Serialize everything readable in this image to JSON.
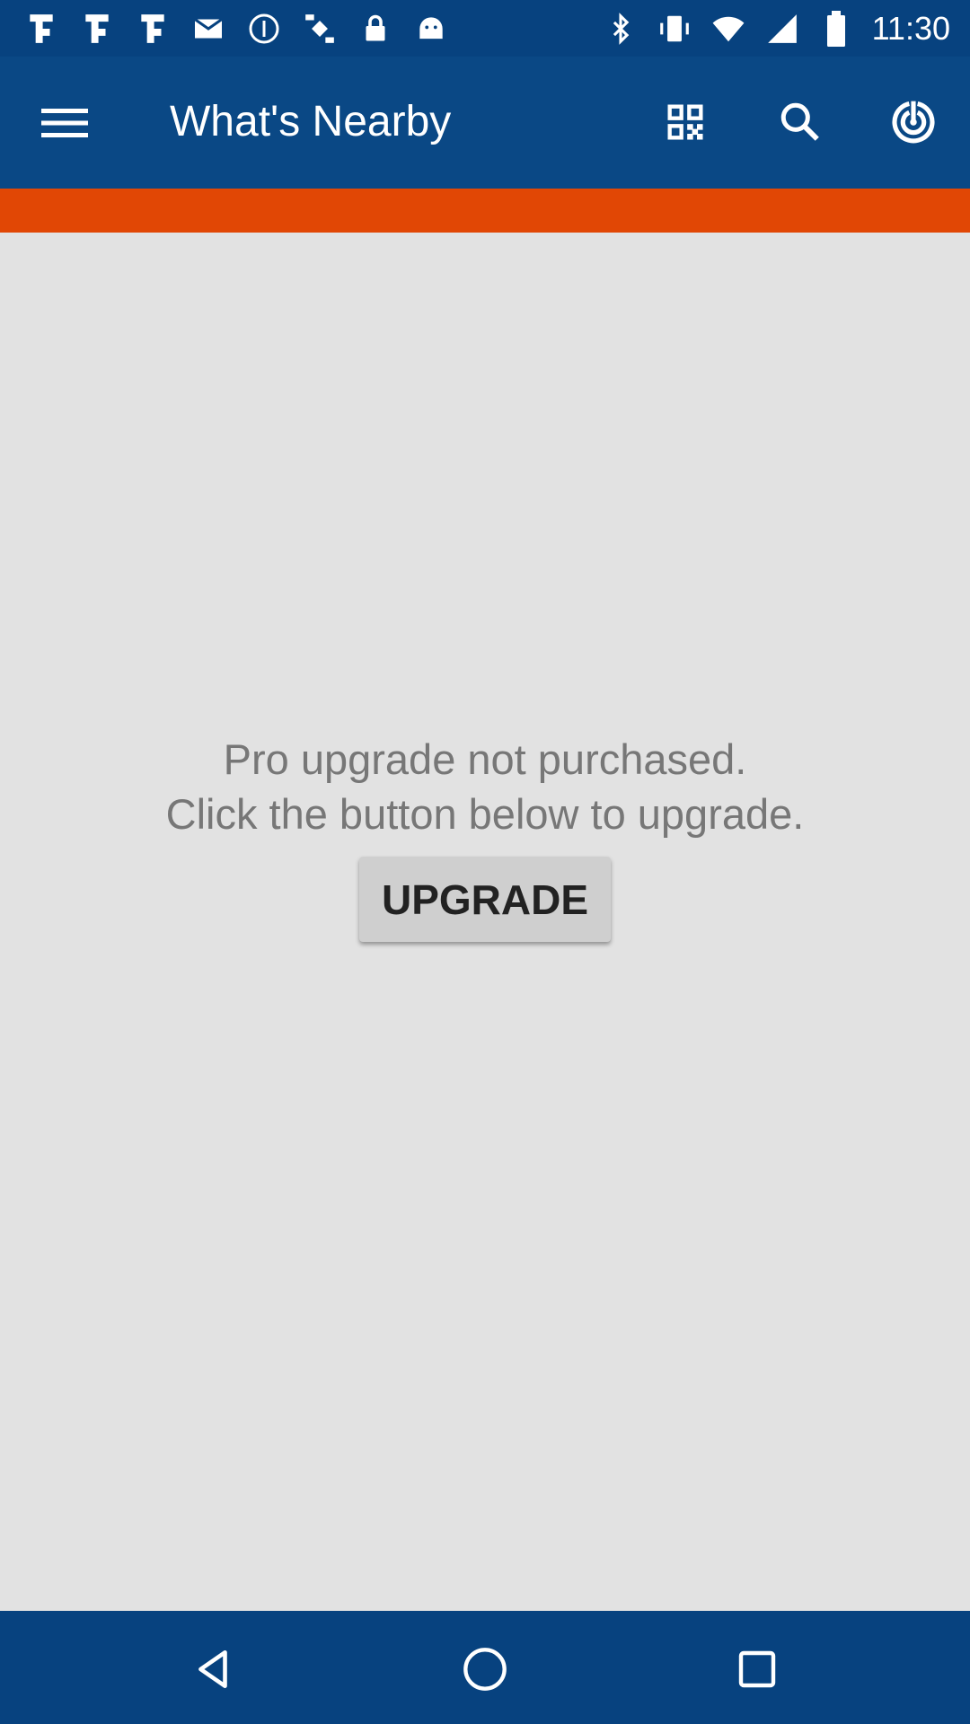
{
  "status_bar": {
    "time": "11:30",
    "left_icons": [
      "notification-app-icon",
      "notification-app-icon",
      "notification-app-icon",
      "gmail-icon",
      "info-icon",
      "fake-gps-icon",
      "lock-icon",
      "android-icon"
    ],
    "right_icons": [
      "bluetooth-icon",
      "vibrate-icon",
      "wifi-icon",
      "signal-icon",
      "battery-icon"
    ]
  },
  "app_bar": {
    "title": "What's Nearby",
    "actions": [
      "qr-code-icon",
      "search-icon",
      "radar-icon"
    ]
  },
  "colors": {
    "status_bar": "#07427f",
    "app_bar": "#0a4885",
    "accent_strip": "#e14705",
    "background": "#e2e2e2",
    "nav_bar": "#07427f"
  },
  "main": {
    "message_line1": "Pro upgrade not purchased.",
    "message_line2": "Click the button below to upgrade.",
    "upgrade_label": "UPGRADE"
  },
  "nav": [
    "back-icon",
    "home-icon",
    "recents-icon"
  ]
}
